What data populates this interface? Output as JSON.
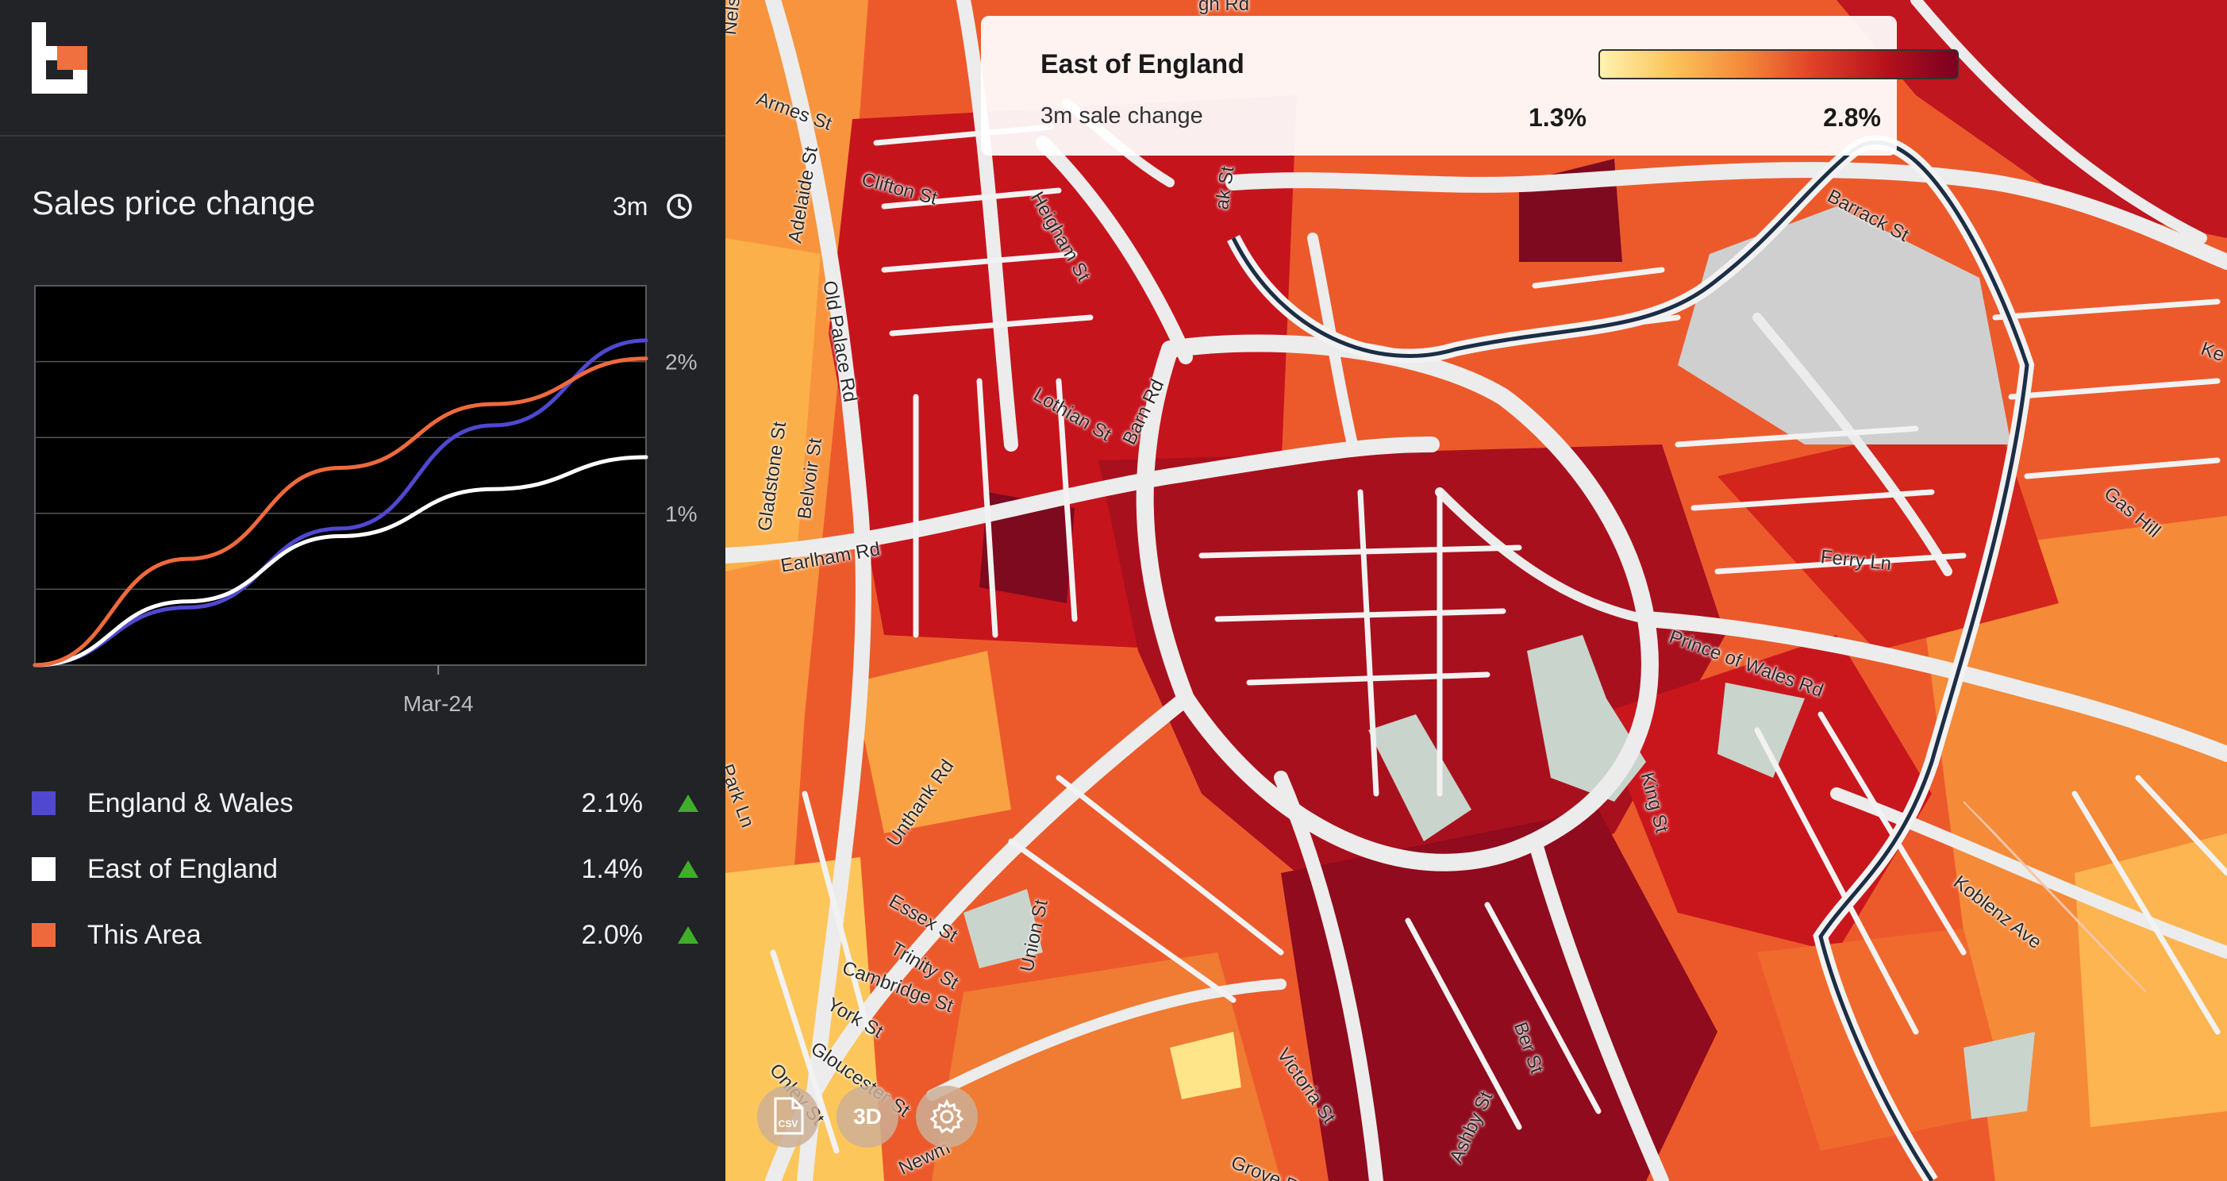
{
  "panel": {
    "title": "Sales price change",
    "period": "3m"
  },
  "chart_data": {
    "type": "line",
    "x_tick_labels": [
      "Mar-24"
    ],
    "y_tick_labels": [
      "1%",
      "2%"
    ],
    "ylim": [
      0,
      2.5
    ],
    "grid": true,
    "series": [
      {
        "name": "England & Wales",
        "color": "#5048d0",
        "values": [
          0,
          0.38,
          0.9,
          1.58,
          2.14
        ]
      },
      {
        "name": "East of England",
        "color": "#ffffff",
        "values": [
          0,
          0.42,
          0.85,
          1.16,
          1.37
        ]
      },
      {
        "name": "This Area",
        "color": "#ee6a3d",
        "values": [
          0,
          0.7,
          1.3,
          1.72,
          2.02
        ]
      }
    ]
  },
  "legend": [
    {
      "label": "England & Wales",
      "value": "2.1%",
      "color": "#5048d0"
    },
    {
      "label": "East of England",
      "value": "1.4%",
      "color": "#ffffff"
    },
    {
      "label": "This Area",
      "value": "2.0%",
      "color": "#ee6a3d"
    }
  ],
  "map_legend": {
    "region": "East of England",
    "metric": "3m sale change",
    "min": "1.3%",
    "max": "2.8%"
  },
  "map_buttons": {
    "csv": "CSV",
    "three_d": "3D"
  },
  "streets": [
    "Nelson",
    "Armes St",
    "Adelaide St",
    "Clifton St",
    "Old Palace Rd",
    "Heigham St",
    "ak St",
    "Barrack St",
    "Lothian St",
    "Barn Rd",
    "Gladstone St",
    "Belvoir St",
    "Earlham Rd",
    "Ferry Ln",
    "Gas Hill",
    "Prince of Wales Rd",
    "Park Ln",
    "Unthank Rd",
    "Essex St",
    "Trinity St",
    "Cambridge St",
    "York St",
    "Gloucester St",
    "Union St",
    "King St",
    "Koblenz Ave",
    "Onley St",
    "Victoria St",
    "Ber St",
    "Ashby St",
    "Grove R",
    "Newm",
    "Ke",
    "gh Rd"
  ],
  "colors": {
    "accent_arrow": "#3fae2a",
    "sidebar_bg": "#212327"
  },
  "icons": [
    "logo-icon",
    "clock-icon",
    "triangle-up-icon",
    "csv-icon",
    "settings-gear-icon"
  ]
}
